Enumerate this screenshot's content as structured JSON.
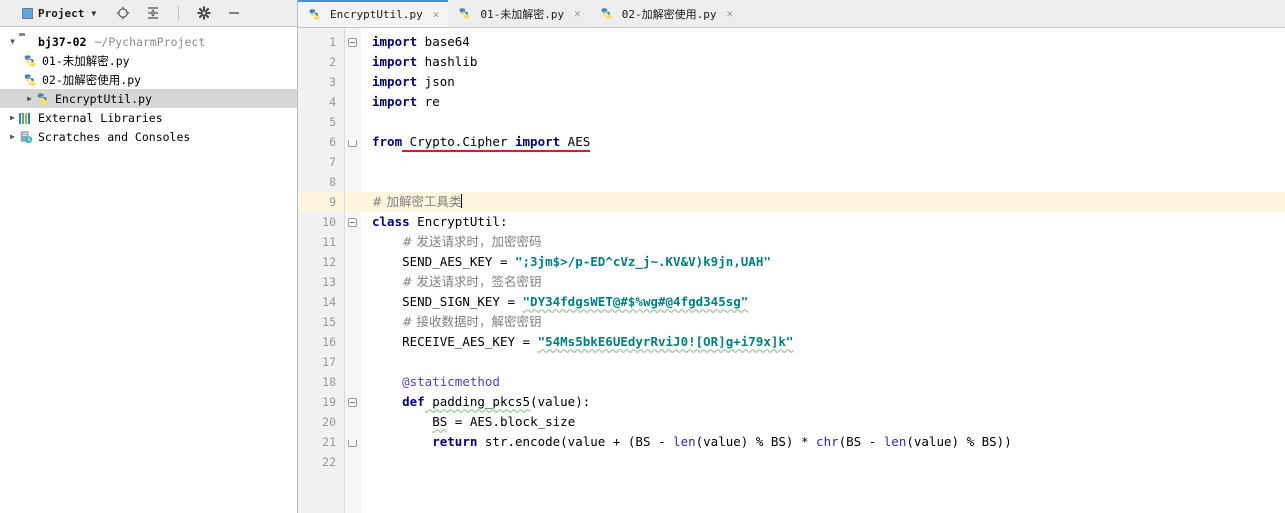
{
  "sidebar": {
    "toolbar": {
      "title": "Project",
      "dropdown_caret": "▼",
      "icons": [
        {
          "name": "locate-icon",
          "glyph": "⊕"
        },
        {
          "name": "collapse-all-icon",
          "glyph": "⇵"
        },
        {
          "name": "settings-gear-icon",
          "glyph": "✿"
        },
        {
          "name": "hide-panel-icon",
          "glyph": "—"
        }
      ]
    },
    "tree": [
      {
        "id": "project-root",
        "icon": "folder-icon",
        "twisty": "▼",
        "label": "bj37-02",
        "path": "~/PycharmProject",
        "indent": 1,
        "selected": false
      },
      {
        "id": "file-01",
        "icon": "python-file-icon",
        "twisty": "",
        "label": "01-未加解密.py",
        "path": "",
        "indent": 2,
        "selected": false
      },
      {
        "id": "file-02",
        "icon": "python-file-icon",
        "twisty": "",
        "label": "02-加解密使用.py",
        "path": "",
        "indent": 2,
        "selected": false
      },
      {
        "id": "file-encryptutil",
        "icon": "python-file-icon",
        "twisty": "▶",
        "label": "EncryptUtil.py",
        "path": "",
        "indent": 2,
        "selected": true
      },
      {
        "id": "external-libraries",
        "icon": "libraries-icon",
        "twisty": "▶",
        "label": "External Libraries",
        "path": "",
        "indent": 1,
        "selected": false
      },
      {
        "id": "scratches-consoles",
        "icon": "scratches-icon",
        "twisty": "▶",
        "label": "Scratches and Consoles",
        "path": "",
        "indent": 1,
        "selected": false
      }
    ]
  },
  "editor": {
    "tabs": [
      {
        "label": "EncryptUtil.py",
        "icon": "python-file-icon",
        "close": "✕",
        "active": true
      },
      {
        "label": "01-未加解密.py",
        "icon": "python-file-icon",
        "close": "✕",
        "active": false
      },
      {
        "label": "02-加解密使用.py",
        "icon": "python-file-icon",
        "close": "✕",
        "active": false
      }
    ],
    "line_numbers": [
      "1",
      "2",
      "3",
      "4",
      "5",
      "6",
      "7",
      "8",
      "9",
      "10",
      "11",
      "12",
      "13",
      "14",
      "15",
      "16",
      "17",
      "18",
      "19",
      "20",
      "21",
      "22"
    ],
    "highlighted_line": 9,
    "caret_line": 9,
    "code": {
      "l1_import": "import",
      "l1_mod": " base64",
      "l2_import": "import",
      "l2_mod": " hashlib",
      "l3_import": "import",
      "l3_mod": " json",
      "l4_import": "import",
      "l4_mod": " re",
      "l6_from": "from",
      "l6_pkg": " Crypto.Cipher ",
      "l6_import": "import",
      "l6_name": " AES",
      "l9_comment": "# 加解密工具类",
      "l10_class": "class",
      "l10_name": " EncryptUtil:",
      "l11_comment": "# 发送请求时，加密密码",
      "l12_name": "SEND_AES_KEY = ",
      "l12_value": "\";3jm$>/p-ED^cVz_j~.KV&V)k9jn,UAH\"",
      "l13_comment": "# 发送请求时，签名密钥",
      "l14_name": "SEND_SIGN_KEY = ",
      "l14_value": "\"DY34fdgsWET@#$%wg#@4fgd345sg\"",
      "l15_comment": "# 接收数据时，解密密钥",
      "l16_name": "RECEIVE_AES_KEY = ",
      "l16_value": "\"54Ms5bkE6UEdyrRviJ0![OR]g+i79x]k\"",
      "l18_decorator": "@staticmethod",
      "l19_def": "def",
      "l19_sig_a": " padding_pkcs5",
      "l19_sig_b": "(value):",
      "l20_a": "BS",
      "l20_b": " = AES.block_size",
      "l21_return": "return",
      "l21_a": " str.encode(value + (BS - ",
      "l21_len1": "len",
      "l21_b": "(value) % BS) * ",
      "l21_chr": "chr",
      "l21_c": "(BS - ",
      "l21_len2": "len",
      "l21_d": "(value) % BS))"
    }
  },
  "colors": {
    "keyword": "#000080",
    "string": "#008080",
    "comment": "#808080",
    "decorator": "#4646c8",
    "builtin": "#2a2ab0",
    "error_underline": "#e01b1b",
    "highlight_line": "#fdf6dd",
    "selection": "#d6d6d6",
    "tab_active_border": "#4a90d9"
  }
}
